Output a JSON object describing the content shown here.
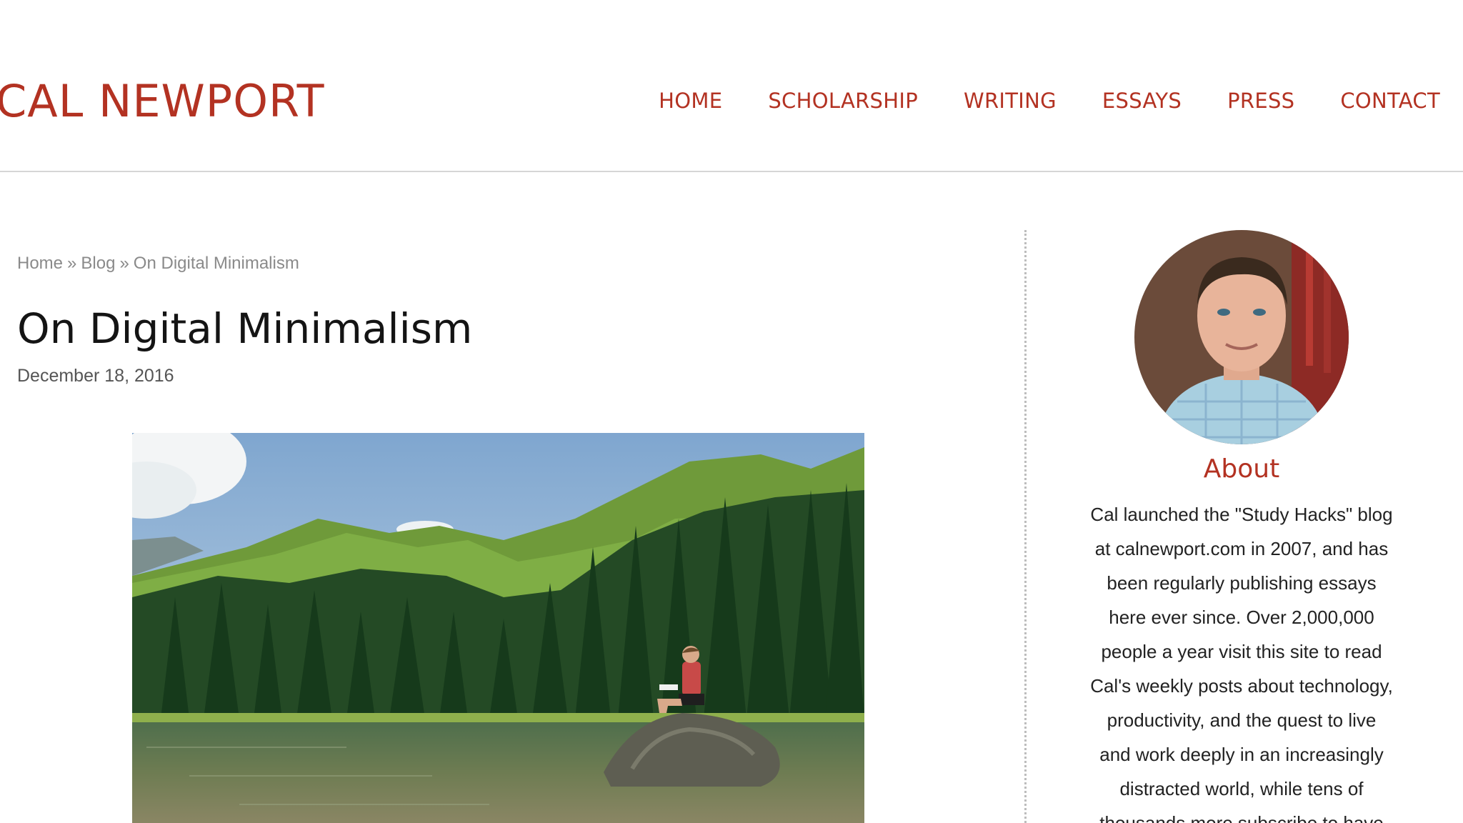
{
  "header": {
    "site_title": "CAL NEWPORT",
    "nav": [
      {
        "label": "HOME"
      },
      {
        "label": "SCHOLARSHIP"
      },
      {
        "label": "WRITING"
      },
      {
        "label": "ESSAYS"
      },
      {
        "label": "PRESS"
      },
      {
        "label": "CONTACT"
      }
    ]
  },
  "breadcrumb": {
    "items": [
      "Home",
      "Blog",
      "On Digital Minimalism"
    ],
    "separator": "»"
  },
  "post": {
    "title": "On Digital Minimalism",
    "date": "December 18, 2016",
    "image_icon": "mountain-lake-photo-icon"
  },
  "sidebar": {
    "avatar_icon": "author-portrait-icon",
    "about_title": "About",
    "about_lines": [
      "Cal launched the \"Study Hacks\" blog",
      "at calnewport.com in 2007, and has",
      "been regularly publishing essays",
      "here ever since. Over 2,000,000",
      "people a year visit this site to read",
      "Cal's weekly posts about technology,",
      "productivity, and the quest to live",
      "and work deeply in an increasingly",
      "distracted world, while tens of",
      "thousands more subscribe to have"
    ]
  },
  "colors": {
    "accent": "#b33222",
    "title_text": "#141414",
    "muted_text": "#8a8a8a",
    "divider": "#d6d6d6"
  }
}
